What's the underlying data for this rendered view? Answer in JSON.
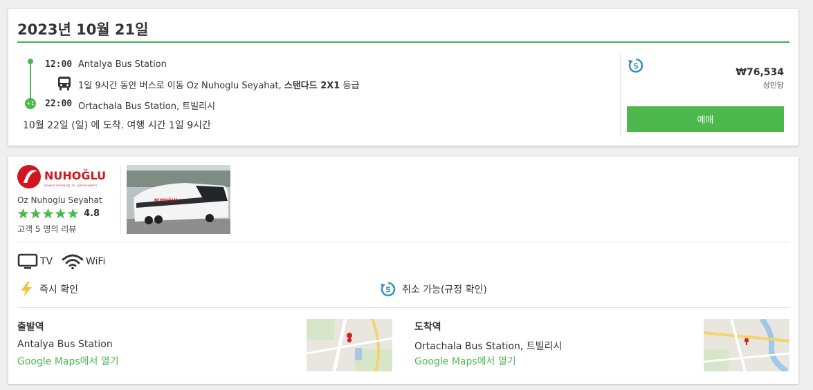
{
  "trip": {
    "date": "2023년 10월 21일",
    "depart_time": "12:00",
    "depart_station": "Antalya Bus Station",
    "route_prefix": "1일 9시간 동안 버스로 이동 Oz Nuhoglu Seyahat, ",
    "bus_class": "스탠다드 2X1",
    "route_suffix": " 등급",
    "arrive_time": "22:00",
    "arrive_station": "Ortachala Bus Station, 트빌리시",
    "day_offset": "+1",
    "arrival_note": "10월 22일 (일) 에 도착. 여행 시간 1일 9시간"
  },
  "pricing": {
    "price": "₩76,534",
    "per": "성인당",
    "book_label": "예매",
    "refund_icon": "refund-icon"
  },
  "operator": {
    "name": "Oz Nuhoglu Seyahat",
    "logo_text": "NUHOĞLU",
    "logo_subtext": "SEYAHAT TURIZM İNŞ. TİC. LIMITED ŞİRKETİ",
    "rating": "4.8",
    "stars": 5,
    "reviews": "고객 5 명의 리뷰"
  },
  "amenities": [
    {
      "icon": "tv-icon",
      "label": "TV"
    },
    {
      "icon": "wifi-icon",
      "label": "WiFi"
    }
  ],
  "features": {
    "instant": "즉시 확인",
    "cancel": "취소 가능(규정 확인)"
  },
  "departure": {
    "label": "출발역",
    "station": "Antalya Bus Station",
    "link": "Google Maps에서 열기"
  },
  "arrival": {
    "label": "도착역",
    "station": "Ortachala Bus Station, 트빌리시",
    "link": "Google Maps에서 열기"
  },
  "colors": {
    "accent": "#4cb84e",
    "refund_blue": "#3d8fc2"
  }
}
